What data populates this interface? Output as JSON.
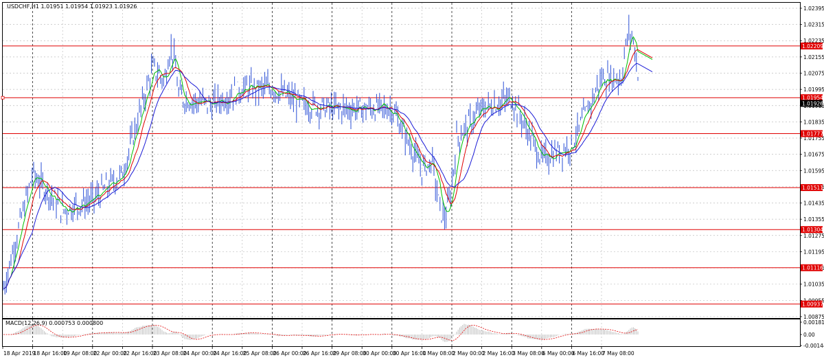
{
  "window": {
    "symbol_info": "USDCHF,H1  1.01951 1.01954 1.01923 1.01926",
    "indicator_label": "MACD(12,26,9) 0.000753 0.000800"
  },
  "colors": {
    "background": "#ffffff",
    "candles": "#2a4fd6",
    "ma_fast": "#00c000",
    "ma_mid": "#e00000",
    "ma_slow": "#1a1ad6",
    "level_line": "#e00000",
    "macd_hist": "#b0b0b0",
    "macd_signal": "#e00000"
  },
  "price_axis": {
    "ticks": [
      "1.02395",
      "1.02315",
      "1.02235",
      "1.02155",
      "1.02075",
      "1.01995",
      "1.01915",
      "1.01835",
      "1.01755",
      "1.01675",
      "1.01595",
      "1.01515",
      "1.01435",
      "1.01355",
      "1.01275",
      "1.01195",
      "1.01115",
      "1.01035",
      "1.00955",
      "1.00875"
    ],
    "range": [
      1.00868,
      1.02422
    ]
  },
  "levels": [
    {
      "price": "1.02209"
    },
    {
      "price": "1.01954"
    },
    {
      "price": "1.01777"
    },
    {
      "price": "1.01511"
    },
    {
      "price": "1.01304"
    },
    {
      "price": "1.01116"
    },
    {
      "price": "1.00937"
    }
  ],
  "current_price": {
    "value": "1.01926"
  },
  "macd_axis": {
    "ticks": [
      "0.001816",
      "0.00",
      "-0.001448"
    ]
  },
  "time_axis": {
    "labels": [
      "18 Apr 2019",
      "18 Apr 16:00",
      "19 Apr 08:00",
      "22 Apr 00:00",
      "22 Apr 16:00",
      "23 Apr 08:00",
      "24 Apr 00:00",
      "24 Apr 16:00",
      "25 Apr 08:00",
      "26 Apr 00:00",
      "26 Apr 16:00",
      "29 Apr 08:00",
      "30 Apr 00:00",
      "30 Apr 16:00",
      "1 May 08:00",
      "2 May 00:00",
      "2 May 16:00",
      "3 May 08:00",
      "6 May 00:00",
      "6 May 16:00",
      "7 May 08:00"
    ]
  },
  "chart_data": {
    "type": "line",
    "series": [
      {
        "name": "USDCHF,H1",
        "x": [
          "18 Apr 2019",
          "18 Apr 16:00",
          "19 Apr 08:00",
          "22 Apr 00:00",
          "22 Apr 16:00",
          "23 Apr 08:00",
          "24 Apr 00:00",
          "24 Apr 16:00",
          "25 Apr 08:00",
          "26 Apr 00:00",
          "26 Apr 16:00",
          "29 Apr 08:00",
          "30 Apr 00:00",
          "30 Apr 16:00",
          "1 May 08:00",
          "2 May 00:00",
          "2 May 16:00",
          "3 May 08:00",
          "6 May 00:00",
          "6 May 16:00",
          "7 May 08:00"
        ],
        "values": [
          1.01,
          1.0158,
          1.014,
          1.0145,
          1.0158,
          1.021,
          1.0195,
          1.0192,
          1.02,
          1.02,
          1.0192,
          1.019,
          1.019,
          1.019,
          1.016,
          1.0172,
          1.019,
          1.0195,
          1.0165,
          1.0172,
          1.0205
        ]
      }
    ],
    "ylim": [
      1.00868,
      1.02422
    ]
  }
}
